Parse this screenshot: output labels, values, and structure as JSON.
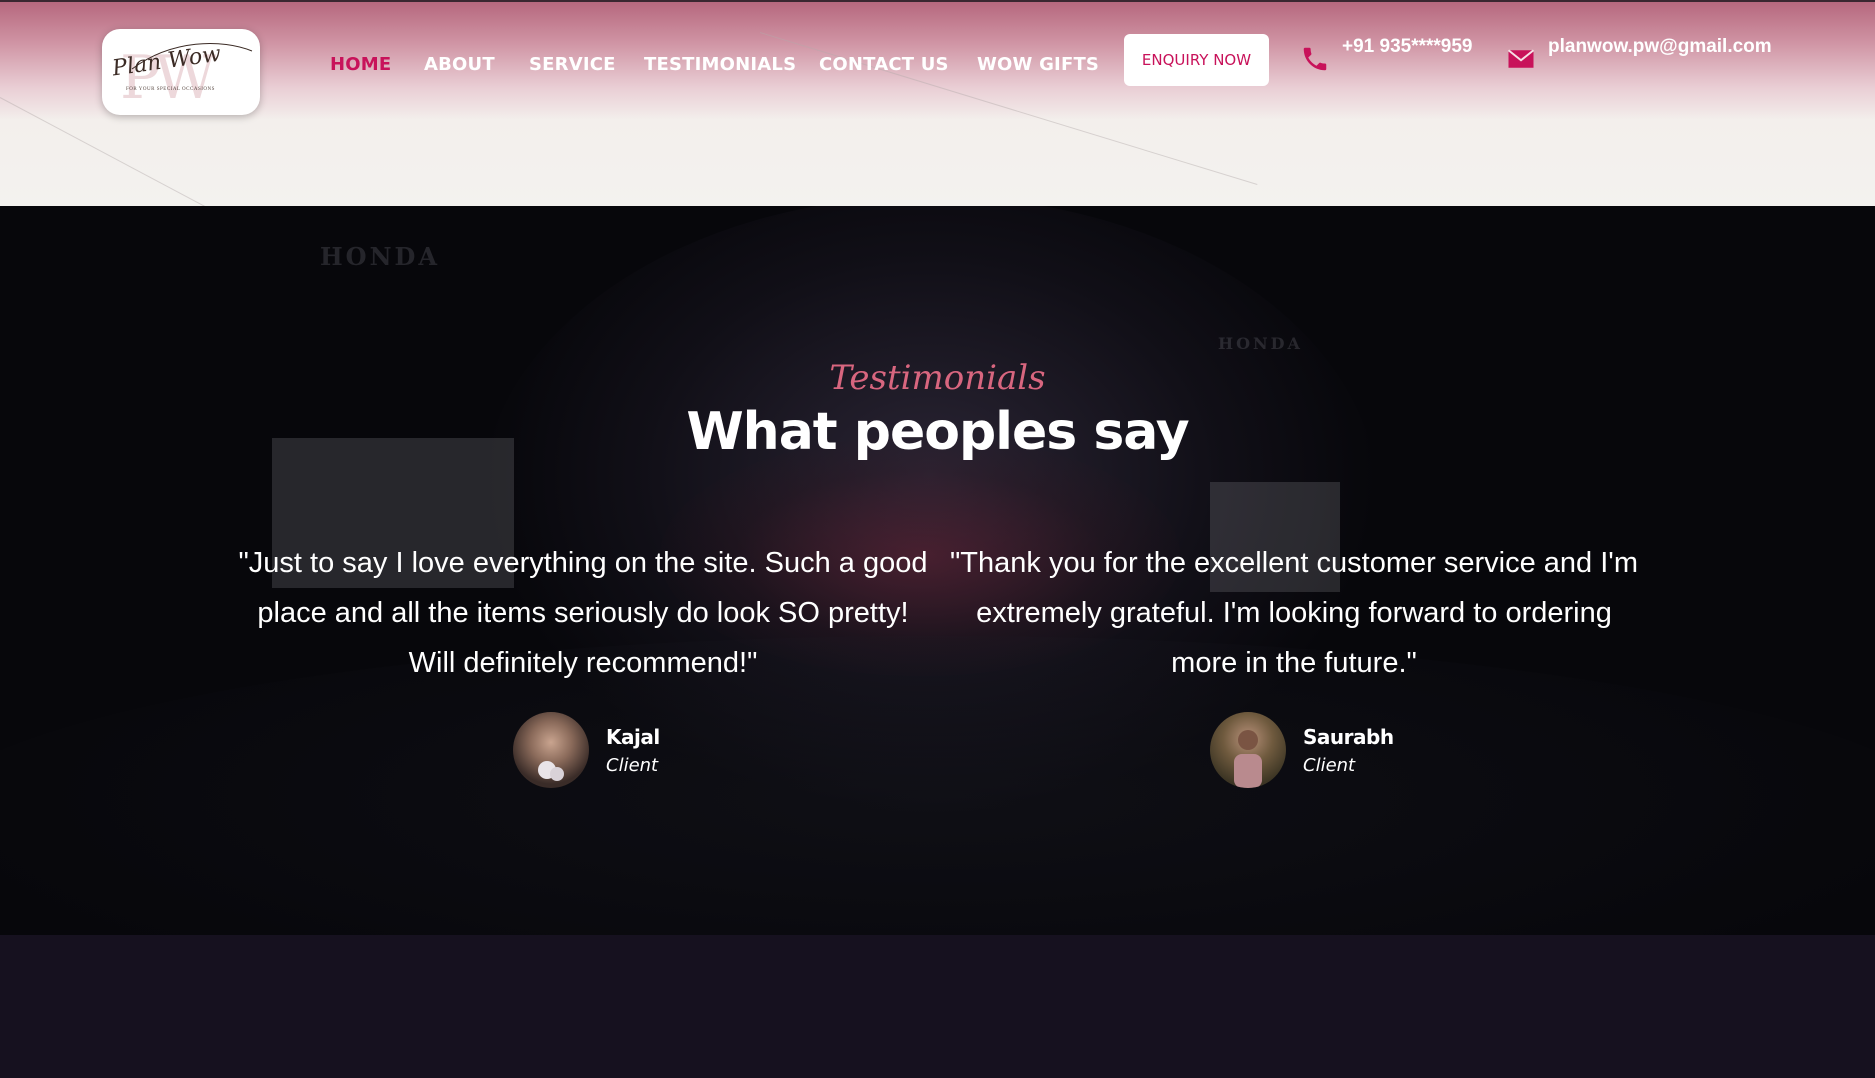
{
  "header": {
    "logo": {
      "monogram": "PW",
      "script": "Plan Wow",
      "tagline": "FOR YOUR SPECIAL OCCASIONS"
    },
    "nav": [
      {
        "label": "HOME",
        "active": true
      },
      {
        "label": "ABOUT",
        "active": false
      },
      {
        "label": "SERVICE",
        "active": false
      },
      {
        "label": "TESTIMONIALS",
        "active": false
      },
      {
        "label": "CONTACT US",
        "active": false
      },
      {
        "label": "WOW GIFTS",
        "active": false
      }
    ],
    "enquiry_label": "ENQUIRY NOW",
    "phone": {
      "icon": "phone-icon",
      "text": "+91 935****959"
    },
    "email": {
      "icon": "envelope-icon",
      "text": "planwow.pw@gmail.com"
    }
  },
  "testimonials": {
    "kicker": "Testimonials",
    "headline": "What peoples say",
    "items": [
      {
        "quote": "\"Just to say I love everything on the site. Such a good place and all the items seriously do look SO pretty! Will definitely recommend!\"",
        "name": "Kajal",
        "role": "Client"
      },
      {
        "quote": "\"Thank you for the excellent customer service and I'm extremely grateful. I'm looking forward to ordering more in the future.\"",
        "name": "Saurabh",
        "role": "Client"
      }
    ],
    "background_text": [
      "HONDA",
      "HONDA"
    ]
  },
  "colors": {
    "accent": "#c8125a",
    "kicker": "#d8667f",
    "header_top": "#b6687e",
    "section_bg": "#07070b",
    "footer_bg": "#16111f"
  }
}
